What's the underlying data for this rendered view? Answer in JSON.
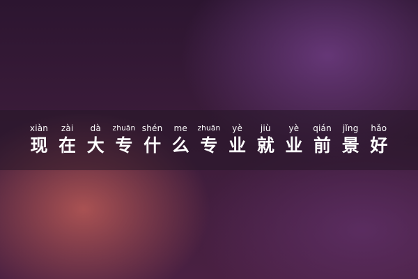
{
  "title": {
    "chars": [
      {
        "py": "xiàn",
        "hz": "现"
      },
      {
        "py": "zài",
        "hz": "在"
      },
      {
        "py": "dà",
        "hz": "大"
      },
      {
        "py": "zhuān",
        "hz": "专"
      },
      {
        "py": "shén",
        "hz": "什"
      },
      {
        "py": "me",
        "hz": "么"
      },
      {
        "py": "zhuān",
        "hz": "专"
      },
      {
        "py": "yè",
        "hz": "业"
      },
      {
        "py": "jiù",
        "hz": "就"
      },
      {
        "py": "yè",
        "hz": "业"
      },
      {
        "py": "qián",
        "hz": "前"
      },
      {
        "py": "jǐng",
        "hz": "景"
      },
      {
        "py": "hǎo",
        "hz": "好"
      }
    ]
  }
}
